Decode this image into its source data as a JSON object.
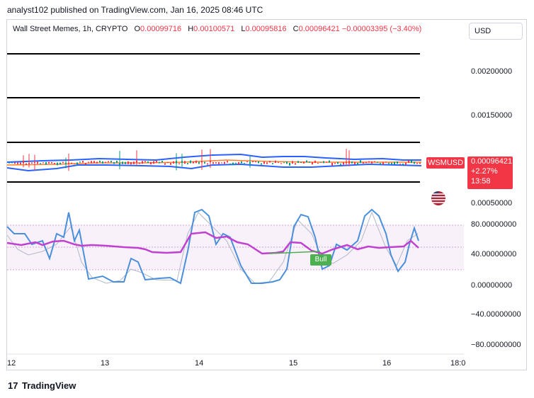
{
  "header": {
    "publisher": "analyst102 published on TradingView.com, Jan 16, 2025 08:46 UTC"
  },
  "legend": {
    "symbol": "Wall Street Memes, 1h, CRYPTO",
    "open_key": "O",
    "open": "0.00099716",
    "high_key": "H",
    "high": "0.00100571",
    "low_key": "L",
    "low": "0.00095816",
    "close_key": "C",
    "close": "0.00096421",
    "change": "−0.00003395 (−3.40%)"
  },
  "currency_button": "USD",
  "price_axis": {
    "labels": [
      "0.00200000",
      "0.00150000",
      "0.00050000"
    ],
    "current_symbol": "WSMUSD",
    "current_price": "0.00096421",
    "current_change": "+2.27%",
    "countdown": "13:58"
  },
  "oscillator_axis": {
    "labels": [
      "80.00000000",
      "40.00000000",
      "0.00000000",
      "−40.00000000",
      "−80.00000000"
    ]
  },
  "time_axis": {
    "labels": [
      "12",
      "13",
      "14",
      "15",
      "16",
      "18:0"
    ]
  },
  "bull_label": "Bull",
  "brand": {
    "logo": "17",
    "name": "TradingView"
  },
  "colors": {
    "down": "#f23645",
    "up": "#089981",
    "band": "#2962ff",
    "rsi": "#c040d0",
    "stoch": "#4a8fdc"
  },
  "icons": {
    "flag": "us-flag-icon",
    "logo": "tradingview-logo-icon"
  }
}
